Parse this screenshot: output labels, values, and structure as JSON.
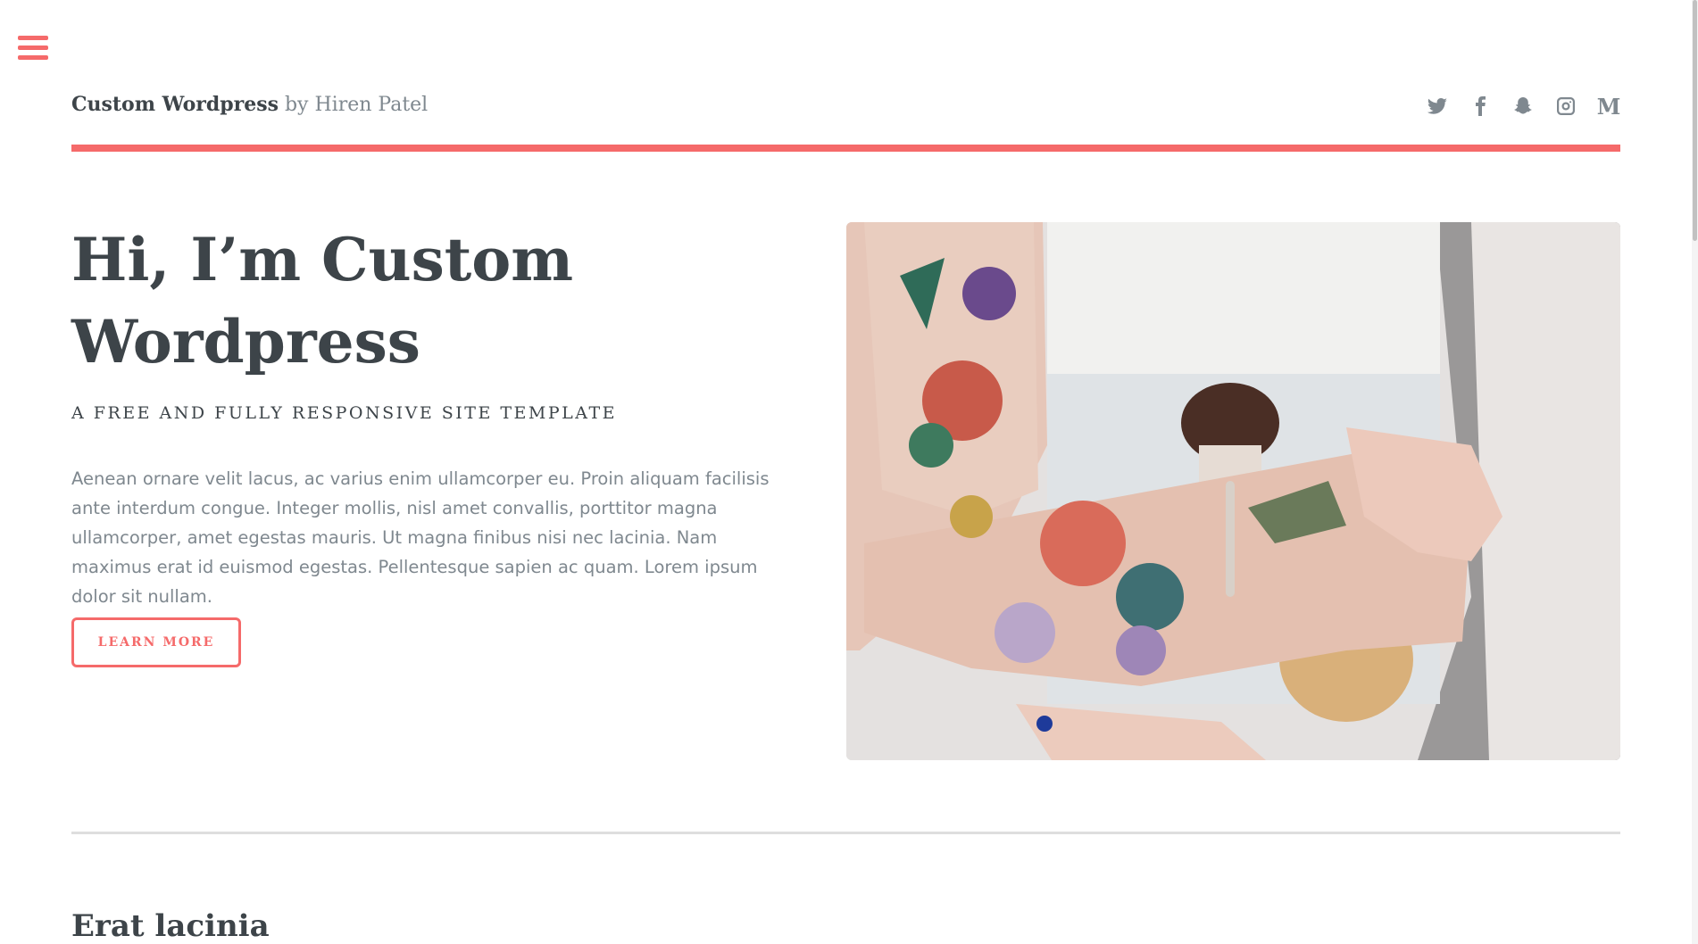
{
  "header": {
    "logo_strong": "Custom Wordpress",
    "logo_rest": " by Hiren Patel",
    "social": [
      {
        "icon": "twitter-icon"
      },
      {
        "icon": "facebook-icon"
      },
      {
        "icon": "snapchat-icon"
      },
      {
        "icon": "instagram-icon"
      },
      {
        "icon": "medium-icon",
        "glyph": "M"
      }
    ]
  },
  "hero": {
    "title_line1": "Hi, I’m Custom",
    "title_line2": "Wordpress",
    "subtitle": "A free and fully responsive site template",
    "body": "Aenean ornare velit lacus, ac varius enim ullamcorper eu. Proin aliquam facilisis ante interdum congue. Integer mollis, nisl amet convallis, porttitor magna ullamcorper, amet egestas mauris. Ut magna finibus nisi nec lacinia. Nam maximus erat id euismod egestas. Pellentesque sapien ac quam. Lorem ipsum dolor sit nullam.",
    "button_label": "LEARN MORE"
  },
  "section": {
    "title": "Erat lacinia"
  },
  "colors": {
    "accent": "#f56a6a",
    "heading": "#3d4449",
    "text": "#7f888f"
  }
}
